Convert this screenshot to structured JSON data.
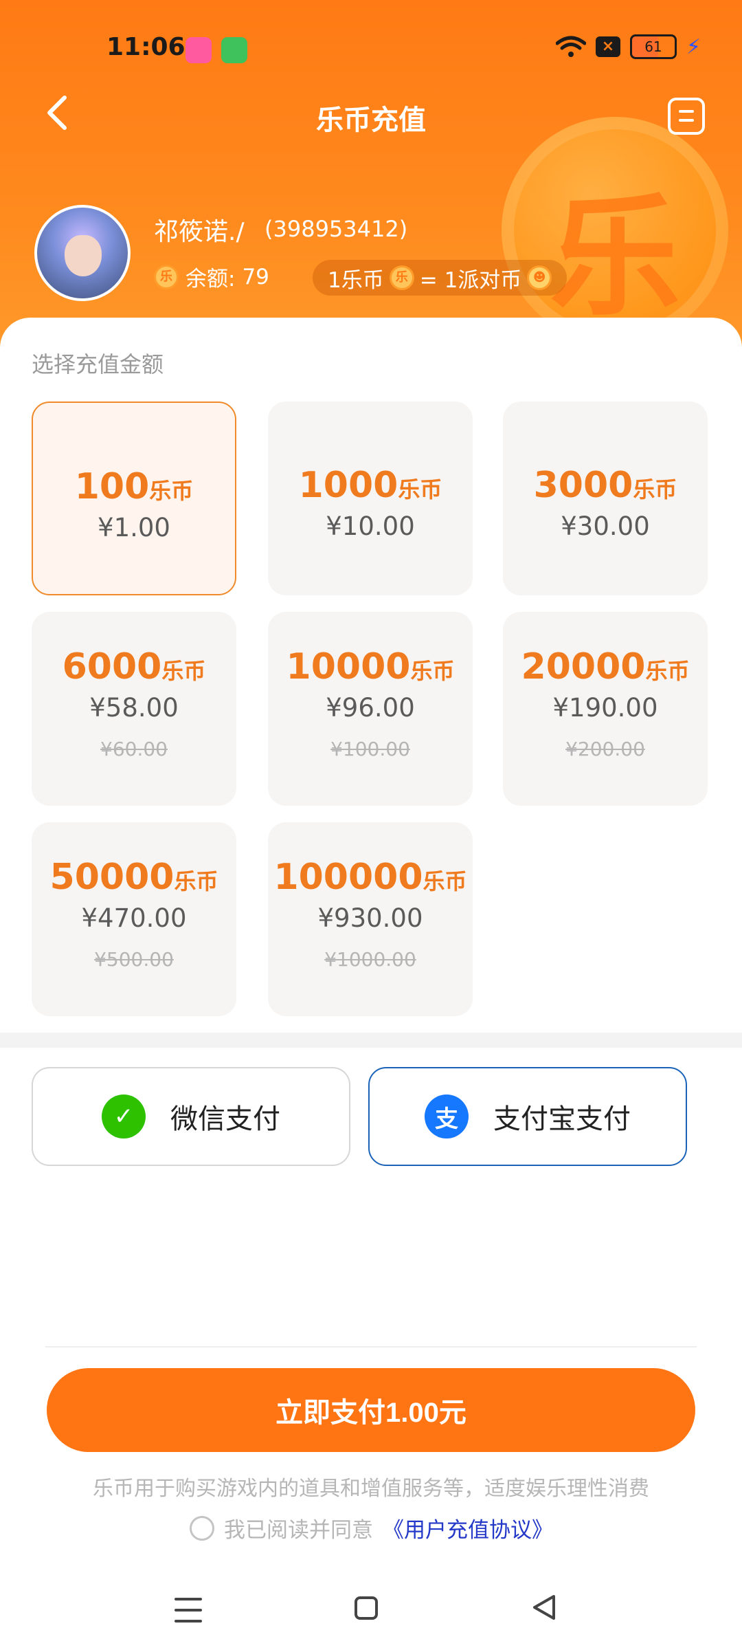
{
  "status_bar": {
    "time": "11:06",
    "battery": "61"
  },
  "header": {
    "title": "乐币充值"
  },
  "user": {
    "name": "祁筱诺./",
    "id": "(398953412)",
    "balance_label": "余额:",
    "balance_value": "79",
    "rate": {
      "left": "1乐币",
      "right": "= 1派对币"
    },
    "coin_glyph": "乐"
  },
  "recharge": {
    "section_label": "选择充值金额",
    "unit": "乐币",
    "packages": [
      {
        "amount": "100",
        "price": "¥1.00",
        "original": "",
        "selected": true
      },
      {
        "amount": "1000",
        "price": "¥10.00",
        "original": ""
      },
      {
        "amount": "3000",
        "price": "¥30.00",
        "original": ""
      },
      {
        "amount": "6000",
        "price": "¥58.00",
        "original": "¥60.00"
      },
      {
        "amount": "10000",
        "price": "¥96.00",
        "original": "¥100.00"
      },
      {
        "amount": "20000",
        "price": "¥190.00",
        "original": "¥200.00"
      },
      {
        "amount": "50000",
        "price": "¥470.00",
        "original": "¥500.00"
      },
      {
        "amount": "100000",
        "price": "¥930.00",
        "original": "¥1000.00"
      }
    ]
  },
  "payment": {
    "wechat": "微信支付",
    "alipay": "支付宝支付",
    "wechat_icon_glyph": "✓",
    "alipay_icon_glyph": "支"
  },
  "footer": {
    "pay_button": "立即支付1.00元",
    "notice": "乐币用于购买游戏内的道具和增值服务等，适度娱乐理性消费",
    "agree_text": "我已阅读并同意",
    "agreement_link": "《用户充值协议》"
  },
  "colors": {
    "accent": "#ff7413",
    "selected_border": "#f08a2a",
    "alipay_border": "#1c63b8"
  }
}
